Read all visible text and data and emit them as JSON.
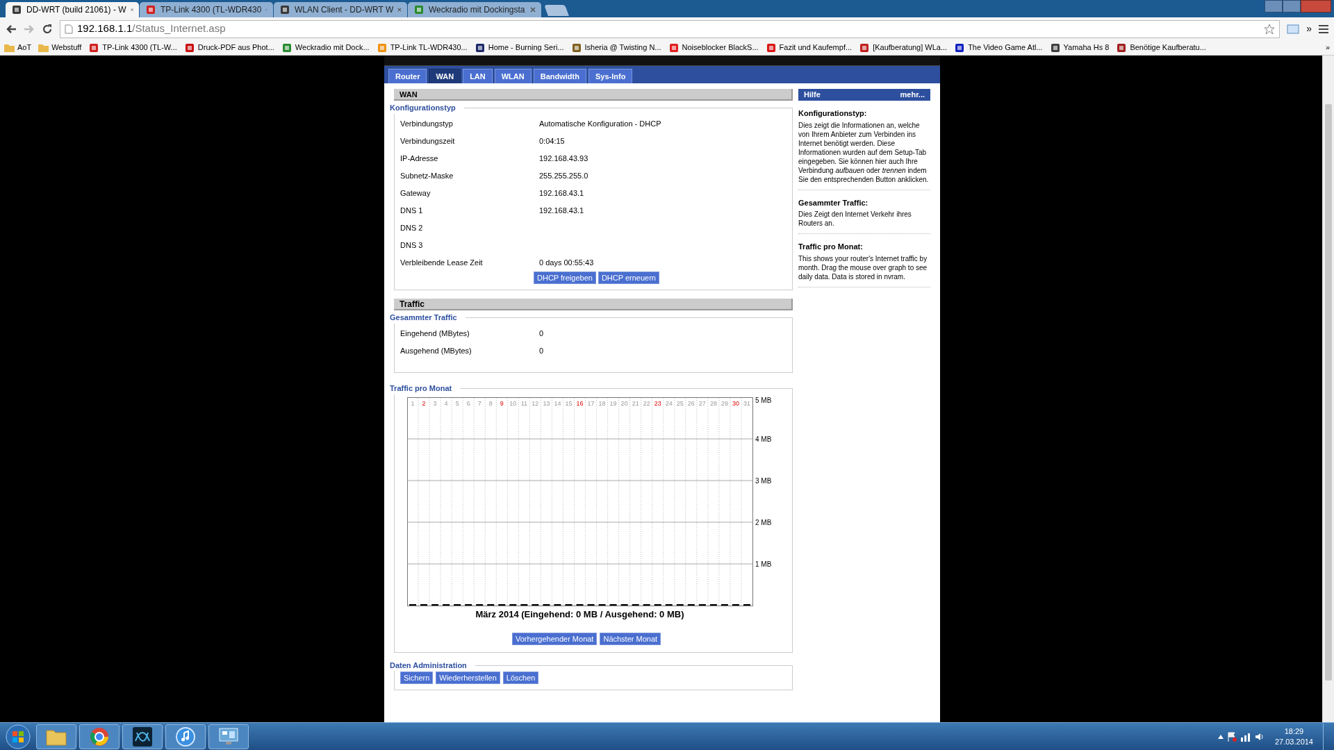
{
  "browser": {
    "tabs": [
      {
        "title": "DD-WRT (build 21061) - W",
        "selected": true,
        "color": "#3a3a3a"
      },
      {
        "title": "TP-Link 4300 (TL-WDR430",
        "selected": false,
        "color": "#d02020"
      },
      {
        "title": "WLAN Client - DD-WRT W",
        "selected": false,
        "color": "#3a3a3a"
      },
      {
        "title": "Weckradio mit Dockingsta",
        "selected": false,
        "color": "#2a8a30"
      }
    ],
    "url_host": "192.168.1.1",
    "url_path": "/Status_Internet.asp",
    "bookmarks": [
      {
        "label": "AoT",
        "kind": "folder",
        "color": "#e8b84a"
      },
      {
        "label": "Webstuff",
        "kind": "folder",
        "color": "#e8b84a"
      },
      {
        "label": "TP-Link 4300 (TL-W...",
        "kind": "site",
        "color": "#d02020"
      },
      {
        "label": "Druck-PDF aus Phot...",
        "kind": "site",
        "color": "#c81010"
      },
      {
        "label": "Weckradio mit Dock...",
        "kind": "site",
        "color": "#2a8a30"
      },
      {
        "label": "TP-Link TL-WDR430...",
        "kind": "site",
        "color": "#f09010"
      },
      {
        "label": "Home - Burning Seri...",
        "kind": "site",
        "color": "#1a2a6a"
      },
      {
        "label": "Isheria @ Twisting N...",
        "kind": "site",
        "color": "#806020"
      },
      {
        "label": "Noiseblocker BlackS...",
        "kind": "site",
        "color": "#e02020"
      },
      {
        "label": "Fazit und Kaufempf...",
        "kind": "site",
        "color": "#d81818"
      },
      {
        "label": "[Kaufberatung] WLa...",
        "kind": "site",
        "color": "#c02020"
      },
      {
        "label": "The Video Game Atl...",
        "kind": "site",
        "color": "#1020c0"
      },
      {
        "label": "Yamaha Hs 8",
        "kind": "site",
        "color": "#404040"
      },
      {
        "label": "Benötige Kaufberatu...",
        "kind": "site",
        "color": "#a02020"
      }
    ],
    "more_bookmarks": "»",
    "extensions_more": "»"
  },
  "router": {
    "tabs": [
      {
        "label": "Router",
        "selected": false
      },
      {
        "label": "WAN",
        "selected": true
      },
      {
        "label": "LAN",
        "selected": false
      },
      {
        "label": "WLAN",
        "selected": false
      },
      {
        "label": "Bandwidth",
        "selected": false
      },
      {
        "label": "Sys-Info",
        "selected": false
      }
    ],
    "wan": {
      "heading": "WAN",
      "legend": "Konfigurationstyp",
      "rows": [
        {
          "label": "Verbindungstyp",
          "value": "Automatische Konfiguration - DHCP"
        },
        {
          "label": "Verbindungszeit",
          "value": "0:04:15"
        },
        {
          "label": "IP-Adresse",
          "value": "192.168.43.93"
        },
        {
          "label": "Subnetz-Maske",
          "value": "255.255.255.0"
        },
        {
          "label": "Gateway",
          "value": "192.168.43.1"
        },
        {
          "label": "DNS 1",
          "value": "192.168.43.1"
        },
        {
          "label": "DNS 2"
        },
        {
          "label": "DNS 3"
        },
        {
          "label": "Verbleibende Lease Zeit",
          "value": "0 days 00:55:43"
        }
      ],
      "buttons": [
        "DHCP freigeben",
        "DHCP erneuern"
      ]
    },
    "traffic": {
      "heading": "Traffic",
      "total_legend": "Gesammter Traffic",
      "total_rows": [
        {
          "label": "Eingehend (MBytes)",
          "value": "0"
        },
        {
          "label": "Ausgehend (MBytes)",
          "value": "0"
        }
      ],
      "monthly_legend": "Traffic pro Monat",
      "day_labels": [
        {
          "label": "1",
          "highlighted": false
        },
        {
          "label": "2",
          "highlighted": true
        },
        {
          "label": "3",
          "highlighted": false
        },
        {
          "label": "4",
          "highlighted": false
        },
        {
          "label": "5",
          "highlighted": false
        },
        {
          "label": "6",
          "highlighted": false
        },
        {
          "label": "7",
          "highlighted": false
        },
        {
          "label": "8",
          "highlighted": false
        },
        {
          "label": "9",
          "highlighted": true
        },
        {
          "label": "10",
          "highlighted": false
        },
        {
          "label": "11",
          "highlighted": false
        },
        {
          "label": "12",
          "highlighted": false
        },
        {
          "label": "13",
          "highlighted": false
        },
        {
          "label": "14",
          "highlighted": false
        },
        {
          "label": "15",
          "highlighted": false
        },
        {
          "label": "16",
          "highlighted": true
        },
        {
          "label": "17",
          "highlighted": false
        },
        {
          "label": "18",
          "highlighted": false
        },
        {
          "label": "19",
          "highlighted": false
        },
        {
          "label": "20",
          "highlighted": false
        },
        {
          "label": "21",
          "highlighted": false
        },
        {
          "label": "22",
          "highlighted": false
        },
        {
          "label": "23",
          "highlighted": true
        },
        {
          "label": "24",
          "highlighted": false
        },
        {
          "label": "25",
          "highlighted": false
        },
        {
          "label": "26",
          "highlighted": false
        },
        {
          "label": "27",
          "highlighted": false
        },
        {
          "label": "28",
          "highlighted": false
        },
        {
          "label": "29",
          "highlighted": false
        },
        {
          "label": "30",
          "highlighted": true
        },
        {
          "label": "31",
          "highlighted": false
        }
      ],
      "chart_data": {
        "type": "bar",
        "title": "März 2014 (Eingehend: 0 MB / Ausgehend: 0 MB)",
        "x": [
          1,
          2,
          3,
          4,
          5,
          6,
          7,
          8,
          9,
          10,
          11,
          12,
          13,
          14,
          15,
          16,
          17,
          18,
          19,
          20,
          21,
          22,
          23,
          24,
          25,
          26,
          27,
          28,
          29,
          30,
          31
        ],
        "grid": true,
        "series": [
          {
            "color": "#000000",
            "values": [
              0,
              0,
              0,
              0,
              0,
              0,
              0,
              0,
              0,
              0,
              0,
              0,
              0,
              0,
              0,
              0,
              0,
              0,
              0,
              0,
              0,
              0,
              0,
              0,
              0,
              0,
              0,
              0,
              0,
              0,
              0
            ]
          }
        ],
        "ylim": [
          0,
          5
        ],
        "yticks": [
          {
            "value": 5,
            "label": "5 MB"
          },
          {
            "value": 4,
            "label": "4 MB"
          },
          {
            "value": 3,
            "label": "3 MB"
          },
          {
            "value": 2,
            "label": "2 MB"
          },
          {
            "value": 1,
            "label": "1 MB"
          }
        ]
      },
      "month_buttons": [
        "Vorhergehender Monat",
        "Nächster Monat"
      ]
    },
    "admin": {
      "legend": "Daten Administration",
      "buttons": [
        "Sichern",
        "Wiederherstellen",
        "Löschen"
      ]
    },
    "help": {
      "title": "Hilfe",
      "more": "mehr...",
      "sections": [
        {
          "heading": "Konfigurationstyp:",
          "text": "Dies zeigt die Informationen an, welche von Ihrem Anbieter zum Verbinden ins Internet benötigt werden. Diese Informationen wurden auf dem Setup-Tab eingegeben. Sie können hier auch Ihre Verbindung *aufbauen* oder *trennen* indem Sie den entsprechenden Button anklicken."
        },
        {
          "heading": "Gesammter Traffic:",
          "text": "Dies Zeigt den Internet Verkehr ihres Routers an."
        },
        {
          "heading": "Traffic pro Monat:",
          "text": "This shows your router's Internet traffic by month. Drag the mouse over graph to see daily data. Data is stored in nvram."
        }
      ]
    }
  },
  "taskbar": {
    "apps": [
      {
        "kind": "folder"
      },
      {
        "kind": "globe"
      },
      {
        "kind": "wave"
      },
      {
        "kind": "note"
      },
      {
        "kind": "monitor"
      }
    ],
    "time": "18:29",
    "date": "27.03.2014"
  }
}
